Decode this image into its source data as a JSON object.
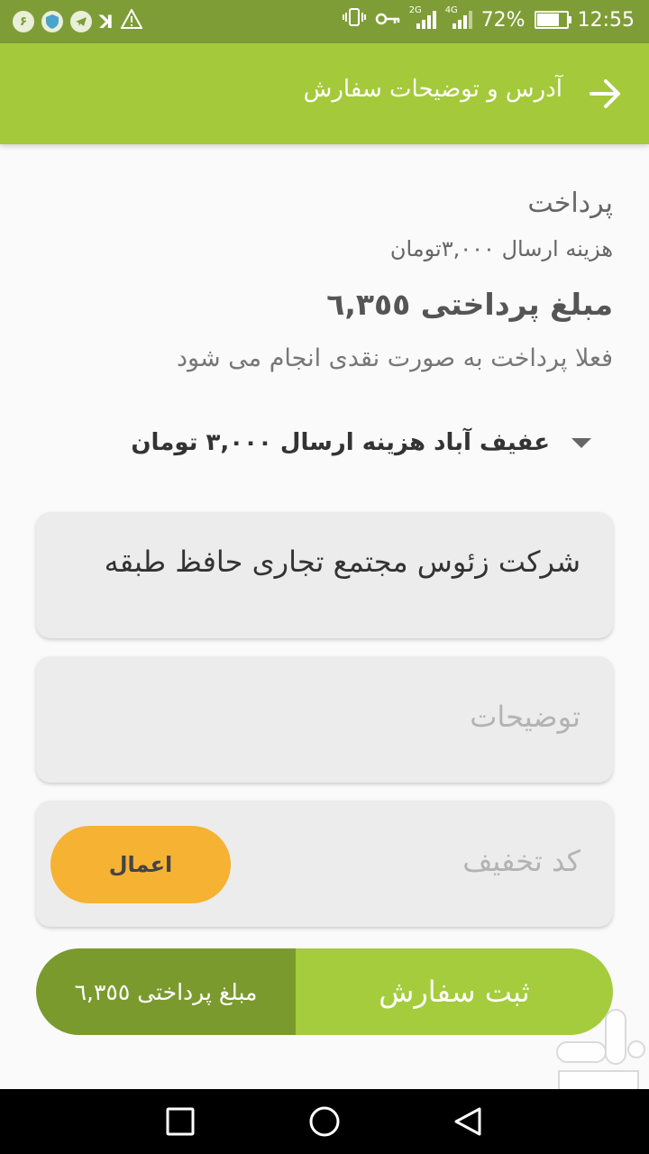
{
  "status_bar": {
    "left_icons": [
      "notification-6-icon",
      "shield-icon",
      "telegram-icon",
      "vpn-icon",
      "warning-icon"
    ],
    "notification_badge": "۶",
    "network_2g": "2G",
    "network_4g": "4G",
    "battery": "72%",
    "battery_level": 0.72,
    "time": "12:55"
  },
  "app_bar": {
    "title": "آدرس و توضیحات سفارش"
  },
  "payment": {
    "label": "پرداخت",
    "shipping_cost": "هزینه ارسال ۳,۰۰۰تومان",
    "amount": "مبلغ پرداختی ٦,٣٥٥",
    "note": "فعلا پرداخت به صورت نقدی انجام می شود"
  },
  "area_spinner": {
    "selected": "عفیف آباد هزینه ارسال ۳,۰۰۰ تومان"
  },
  "address_field": {
    "value": "شرکت زئوس مجتمع تجاری حافظ طبقه"
  },
  "description_field": {
    "placeholder": "توضیحات"
  },
  "discount": {
    "placeholder": "کد تخفیف",
    "apply_label": "اعمال"
  },
  "submit_bar": {
    "amount_label": "مبلغ پرداختی ٦,٣٥٥",
    "submit_label": "ثبت سفارش"
  },
  "colors": {
    "status_bar": "#7f9d36",
    "app_bar": "#a4c93b",
    "submit_button": "#a4cc3c",
    "submit_amount_bg": "#7b9a2e",
    "apply_button": "#f6b233"
  }
}
